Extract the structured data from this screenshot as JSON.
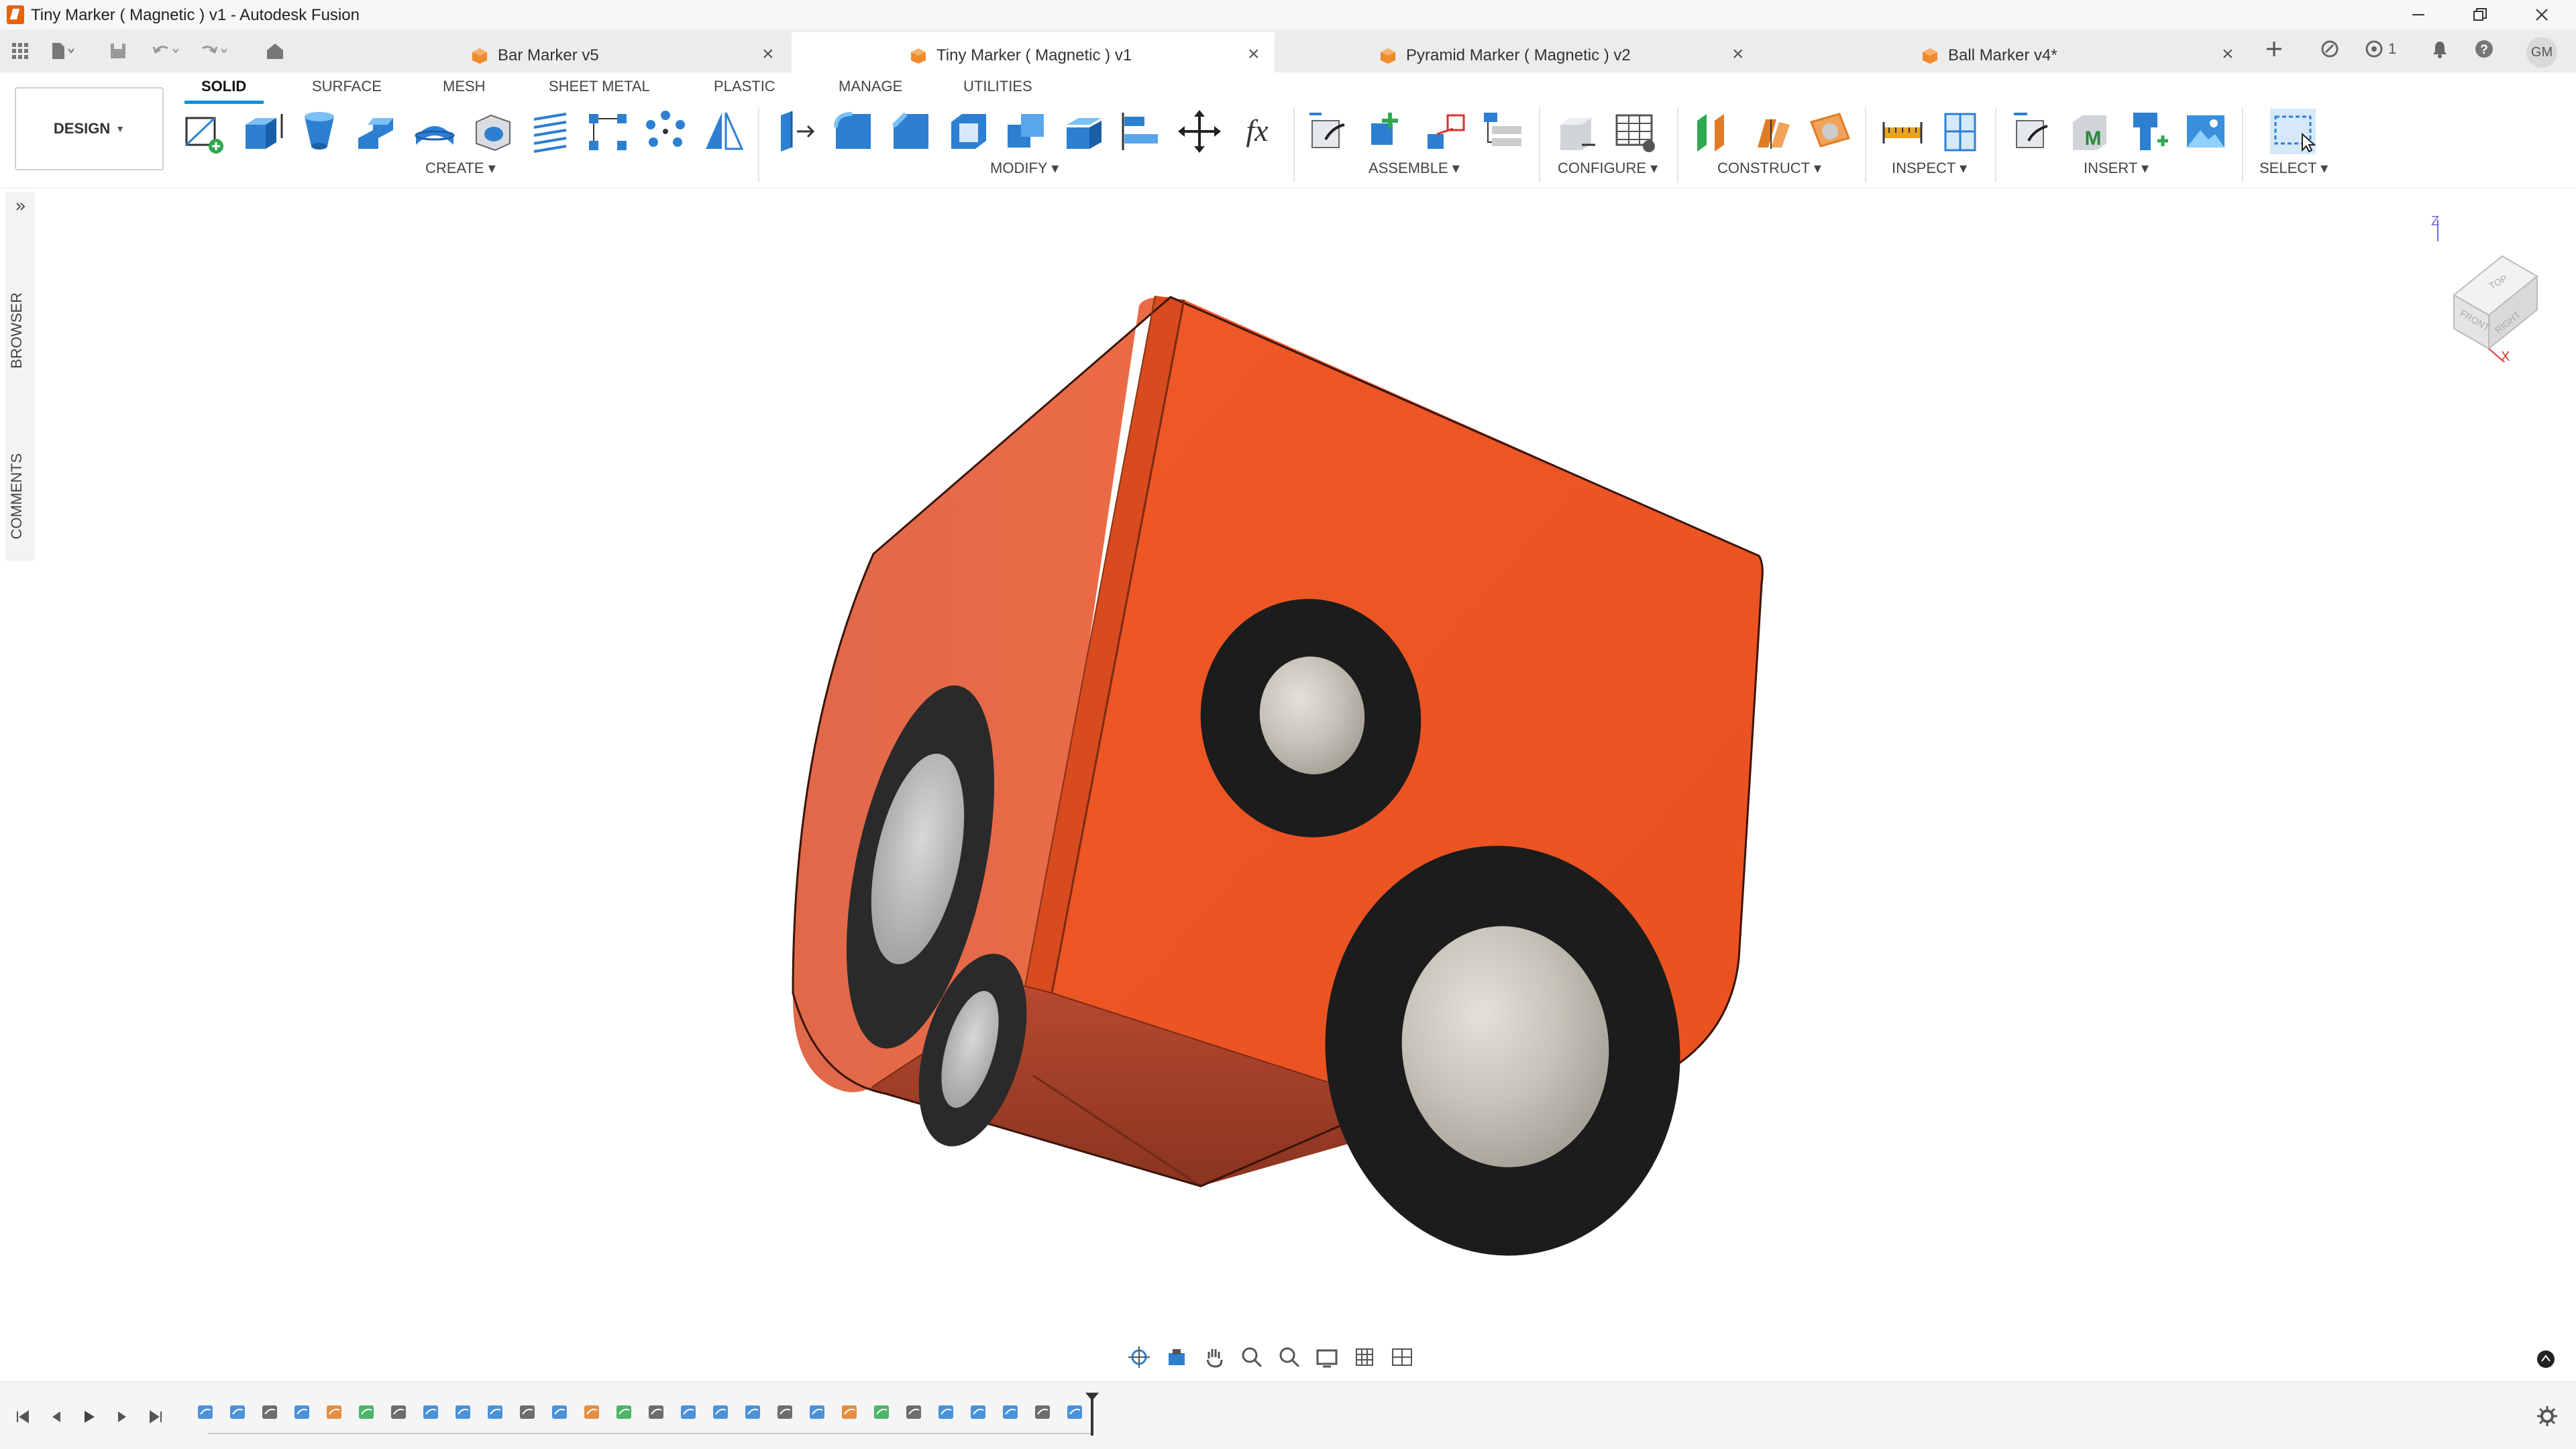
{
  "window": {
    "title": "Tiny Marker ( Magnetic ) v1 - Autodesk Fusion",
    "controls": [
      "minimize",
      "restore",
      "close"
    ]
  },
  "tabs": [
    {
      "label": "Bar Marker v5",
      "active": false
    },
    {
      "label": "Tiny Marker ( Magnetic ) v1",
      "active": true
    },
    {
      "label": "Pyramid Marker ( Magnetic ) v2",
      "active": false
    },
    {
      "label": "Ball Marker v4*",
      "active": false
    }
  ],
  "tabbar_right": {
    "job_count": "1",
    "user_initials": "GM"
  },
  "workspace": {
    "mode_label": "DESIGN",
    "tabs": [
      "SOLID",
      "SURFACE",
      "MESH",
      "SHEET METAL",
      "PLASTIC",
      "MANAGE",
      "UTILITIES"
    ],
    "active_tab": "SOLID"
  },
  "toolbar_groups": [
    {
      "label": "CREATE",
      "tools": [
        "create-sketch",
        "extrude",
        "revolve",
        "sweep",
        "loft",
        "hole",
        "thread",
        "rectangular-pattern",
        "circular-pattern",
        "mirror"
      ]
    },
    {
      "label": "MODIFY",
      "tools": [
        "press-pull",
        "fillet",
        "chamfer",
        "shell",
        "combine",
        "offset-face",
        "align",
        "move",
        "parameters"
      ]
    },
    {
      "label": "ASSEMBLE",
      "tools": [
        "new-component",
        "joint",
        "as-built-joint",
        "joint-origin"
      ]
    },
    {
      "label": "CONFIGURE",
      "tools": [
        "configure",
        "configuration-table"
      ]
    },
    {
      "label": "CONSTRUCT",
      "tools": [
        "offset-plane",
        "plane-at-angle",
        "tangent-plane"
      ]
    },
    {
      "label": "INSPECT",
      "tools": [
        "measure",
        "section-analysis"
      ]
    },
    {
      "label": "INSERT",
      "tools": [
        "insert-derive",
        "insert-mcmaster",
        "insert-mesh",
        "canvas"
      ]
    },
    {
      "label": "SELECT",
      "tools": [
        "select"
      ]
    }
  ],
  "side_panel": {
    "browser_label": "BROWSER",
    "comments_label": "COMMENTS"
  },
  "viewcube": {
    "faces": [
      "TOP",
      "FRONT",
      "RIGHT"
    ],
    "axes": [
      "Z",
      "X"
    ]
  },
  "model": {
    "body_color": "#ef5424",
    "magnet_ring_color": "#1c1c1c",
    "magnet_color": "#c8c6c0"
  },
  "colors": {
    "accent": "#0696d7",
    "brand": "#e8620c"
  },
  "timeline": {
    "feature_count": 28
  }
}
